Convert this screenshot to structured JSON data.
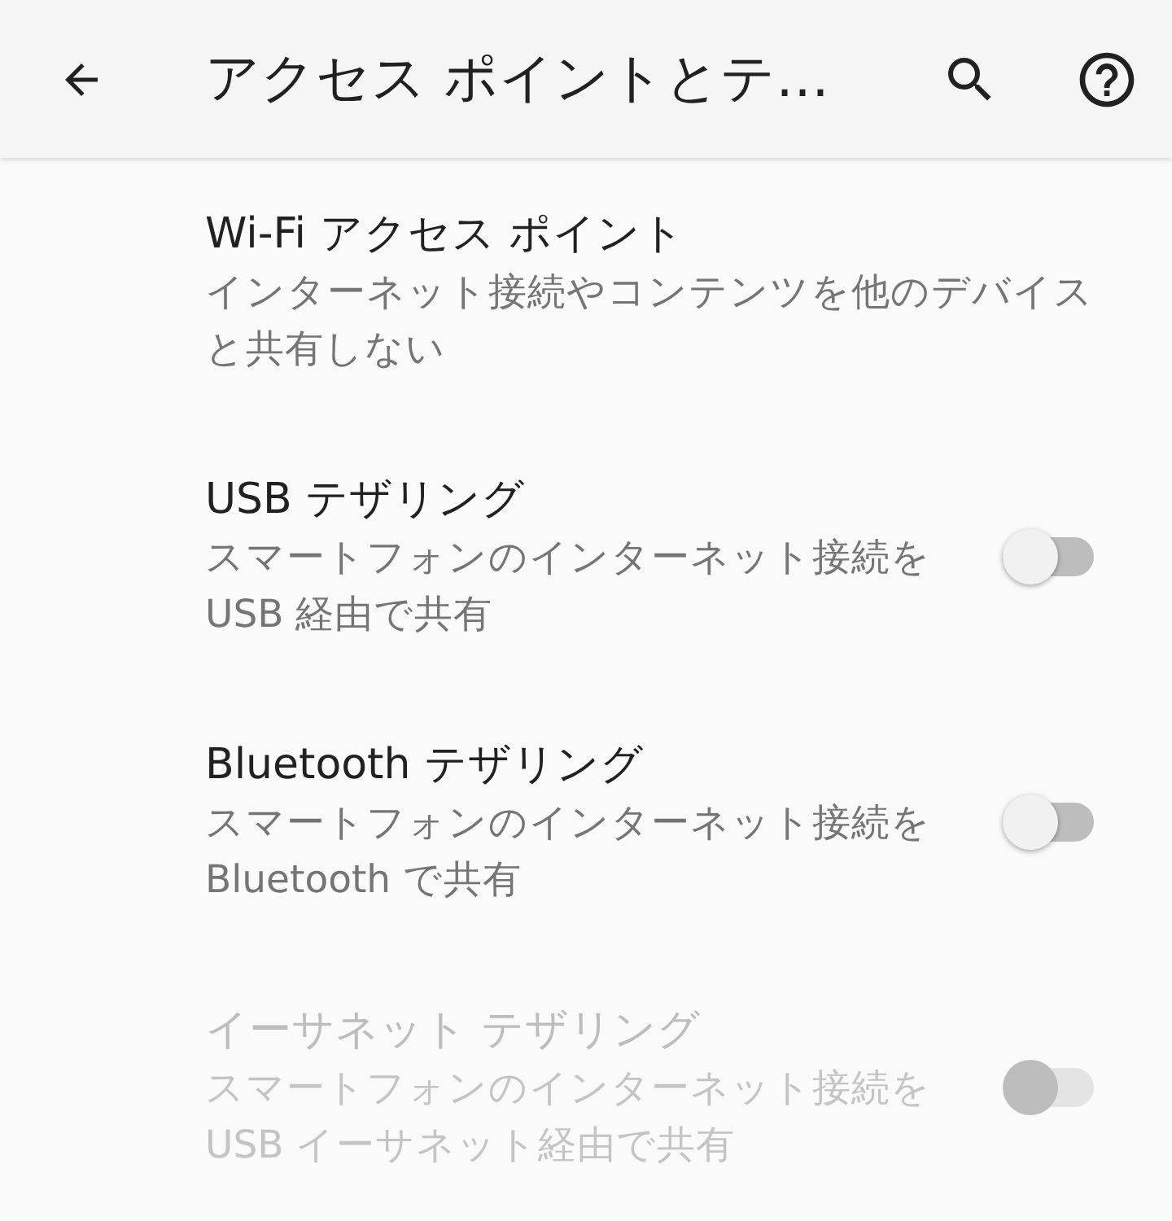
{
  "app_bar": {
    "title": "アクセス ポイントとテ…"
  },
  "settings": [
    {
      "kind": "plain",
      "title": "Wi-Fi アクセス ポイント",
      "summary": "インターネット接続やコンテンツを他のデバイスと共有しない",
      "disabled": false
    },
    {
      "kind": "switch",
      "title": "USB テザリング",
      "summary": "スマートフォンのインターネット接続を USB 経由で共有",
      "on": false,
      "disabled": false
    },
    {
      "kind": "switch",
      "title": "Bluetooth テザリング",
      "summary": "スマートフォンのインターネット接続を Bluetooth で共有",
      "on": false,
      "disabled": false
    },
    {
      "kind": "switch",
      "title": "イーサネット テザリング",
      "summary": "スマートフォンのインターネット接続を USB イーサネット経由で共有",
      "on": false,
      "disabled": true
    }
  ]
}
